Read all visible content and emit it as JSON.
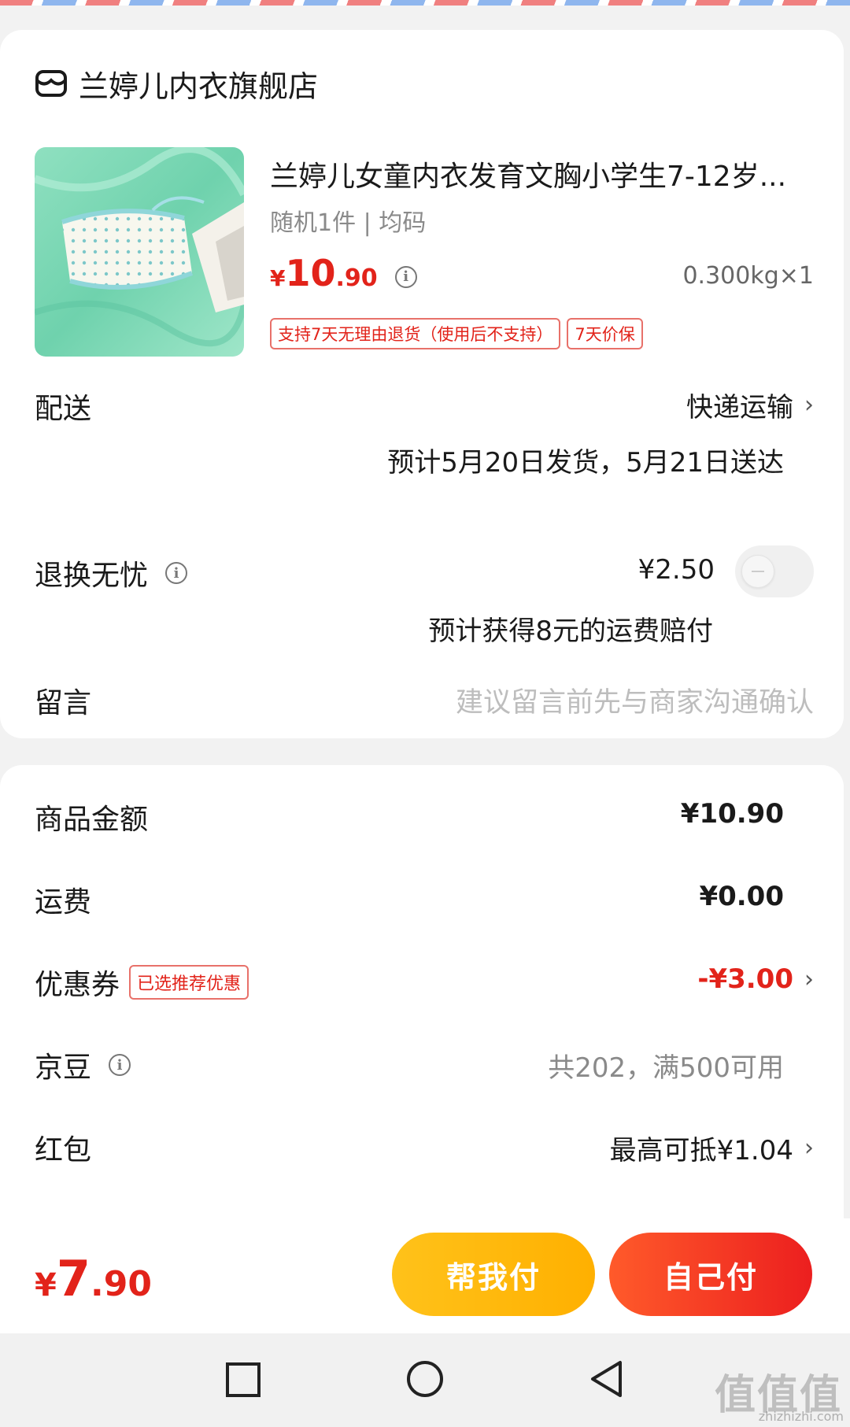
{
  "shop": {
    "name": "兰婷儿内衣旗舰店",
    "icon": "store-icon"
  },
  "product": {
    "title": "兰婷儿女童内衣发育文胸小学生7-12岁...",
    "spec": "随机1件 | 均码",
    "price_yen": "¥",
    "price_int": "10",
    "price_dec": ".90",
    "weight": "0.300kg×1",
    "tags": [
      "支持7天无理由退货（使用后不支持）",
      "7天价保"
    ]
  },
  "delivery": {
    "label": "配送",
    "method": "快递运输",
    "estimate": "预计5月20日发货，5月21日送达"
  },
  "return_insurance": {
    "label": "退换无忧",
    "price": "¥2.50",
    "note": "预计获得8元的运费赔付",
    "enabled": false
  },
  "message": {
    "label": "留言",
    "placeholder": "建议留言前先与商家沟通确认"
  },
  "summary": {
    "goods": {
      "label": "商品金额",
      "value": "¥10.90"
    },
    "shipping": {
      "label": "运费",
      "value": "¥0.00"
    },
    "coupon": {
      "label": "优惠券",
      "tag": "已选推荐优惠",
      "value": "-¥3.00"
    },
    "jingdou": {
      "label": "京豆",
      "value": "共202，满500可用"
    },
    "redpacket": {
      "label": "红包",
      "value": "最高可抵¥1.04"
    }
  },
  "bottom": {
    "total_yen": "¥",
    "total_int": "7",
    "total_dec": ".90",
    "help_pay": "帮我付",
    "self_pay": "自己付"
  },
  "watermark": {
    "text": "值值值",
    "url": "zhizhizhi.com"
  },
  "colors": {
    "accent_red": "#e2231a",
    "help_yellow": "#ffb000",
    "pay_red": "#ec1f1f"
  }
}
